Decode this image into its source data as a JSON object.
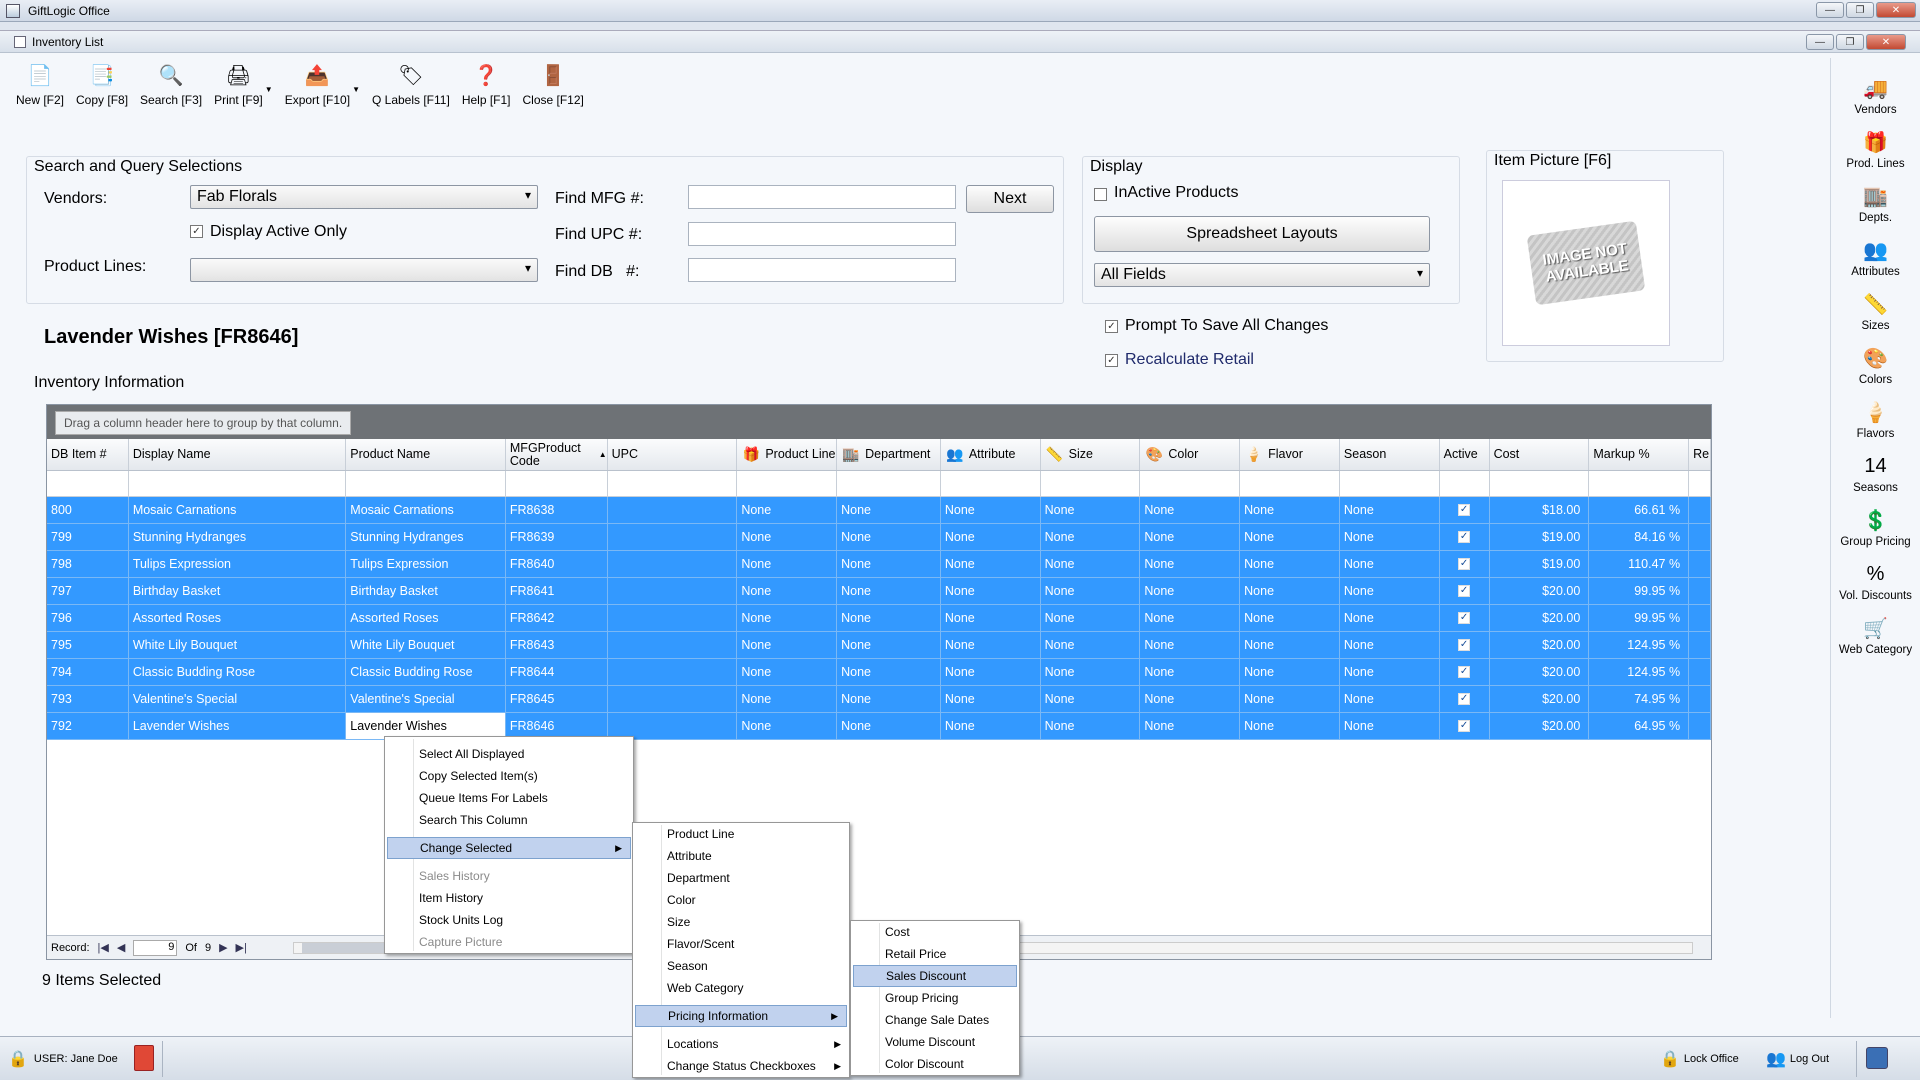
{
  "app": {
    "title": "GiftLogic Office"
  },
  "window": {
    "title": "Inventory List"
  },
  "toolbar": [
    {
      "label": "New [F2]",
      "icon": "new-document-icon",
      "glyph": "📄"
    },
    {
      "label": "Copy [F8]",
      "icon": "copy-icon",
      "glyph": "📑"
    },
    {
      "label": "Search [F3]",
      "icon": "search-icon",
      "glyph": "🔍"
    },
    {
      "label": "Print [F9]",
      "icon": "printer-icon",
      "glyph": "🖨"
    },
    {
      "label": "Export [F10]",
      "icon": "export-icon",
      "glyph": "📤"
    },
    {
      "label": "Q Labels [F11]",
      "icon": "label-tag-icon",
      "glyph": "🏷"
    },
    {
      "label": "Help [F1]",
      "icon": "help-icon",
      "glyph": "❓"
    },
    {
      "label": "Close [F12]",
      "icon": "close-door-icon",
      "glyph": "🚪"
    }
  ],
  "sidebar": [
    {
      "label": "Vendors",
      "icon": "vendors-icon",
      "glyph": "🚚"
    },
    {
      "label": "Prod. Lines",
      "icon": "product-lines-icon",
      "glyph": "🎁"
    },
    {
      "label": "Depts.",
      "icon": "departments-icon",
      "glyph": "🏬"
    },
    {
      "label": "Attributes",
      "icon": "attributes-icon",
      "glyph": "👥"
    },
    {
      "label": "Sizes",
      "icon": "sizes-icon",
      "glyph": "📏"
    },
    {
      "label": "Colors",
      "icon": "colors-icon",
      "glyph": "🎨"
    },
    {
      "label": "Flavors",
      "icon": "flavors-icon",
      "glyph": "🍦"
    },
    {
      "label": "Seasons",
      "icon": "seasons-calendar-icon",
      "glyph": "14"
    },
    {
      "label": "Group Pricing",
      "icon": "group-pricing-icon",
      "glyph": "💲"
    },
    {
      "label": "Vol. Discounts",
      "icon": "volume-discounts-icon",
      "glyph": "%"
    },
    {
      "label": "Web Category",
      "icon": "web-category-cart-icon",
      "glyph": "🛒"
    }
  ],
  "search": {
    "heading": "Search and Query Selections",
    "vendors_label": "Vendors:",
    "vendors_value": "Fab Florals",
    "display_active_label": "Display Active Only",
    "product_lines_label": "Product Lines:",
    "product_lines_value": "",
    "find_mfg_label": "Find MFG #:",
    "find_upc_label": "Find UPC #:",
    "find_db_label": "Find DB   #:",
    "next_label": "Next"
  },
  "display": {
    "heading": "Display",
    "inactive_label": "InActive Products",
    "spreadsheet_label": "Spreadsheet Layouts",
    "fields_value": "All Fields",
    "prompt_label": "Prompt To Save All Changes",
    "recalc_label": "Recalculate Retail"
  },
  "item_picture": {
    "heading": "Item Picture [F6]",
    "placeholder": "IMAGE NOT AVAILABLE"
  },
  "item_title": "Lavender Wishes  [FR8646]",
  "inventory": {
    "heading": "Inventory Information",
    "group_hint": "Drag a column header here to group by that column.",
    "columns": [
      {
        "label": "DB Item #",
        "icon": ""
      },
      {
        "label": "Display Name",
        "icon": ""
      },
      {
        "label": "Product Name",
        "icon": ""
      },
      {
        "label": "MFGProduct Code",
        "icon": ""
      },
      {
        "label": "UPC",
        "icon": ""
      },
      {
        "label": "Product Line",
        "icon": "🎁"
      },
      {
        "label": "Department",
        "icon": "🏬"
      },
      {
        "label": "Attribute",
        "icon": "👥"
      },
      {
        "label": "Size",
        "icon": "📏"
      },
      {
        "label": "Color",
        "icon": "🎨"
      },
      {
        "label": "Flavor",
        "icon": "🍦"
      },
      {
        "label": "Season",
        "icon": ""
      },
      {
        "label": "Active",
        "icon": ""
      },
      {
        "label": "Cost",
        "icon": ""
      },
      {
        "label": "Markup %",
        "icon": ""
      },
      {
        "label": "Re",
        "icon": ""
      }
    ],
    "rows": [
      {
        "id": "800",
        "display": "Mosaic Carnations",
        "product": "Mosaic Carnations",
        "mfg": "FR8638",
        "upc": "",
        "line": "None",
        "dept": "None",
        "attr": "None",
        "size": "None",
        "color": "None",
        "flavor": "None",
        "season": "None",
        "cost": "$18.00",
        "markup": "66.61 %"
      },
      {
        "id": "799",
        "display": "Stunning Hydranges",
        "product": "Stunning Hydranges",
        "mfg": "FR8639",
        "upc": "",
        "line": "None",
        "dept": "None",
        "attr": "None",
        "size": "None",
        "color": "None",
        "flavor": "None",
        "season": "None",
        "cost": "$19.00",
        "markup": "84.16 %"
      },
      {
        "id": "798",
        "display": "Tulips Expression",
        "product": "Tulips Expression",
        "mfg": "FR8640",
        "upc": "",
        "line": "None",
        "dept": "None",
        "attr": "None",
        "size": "None",
        "color": "None",
        "flavor": "None",
        "season": "None",
        "cost": "$19.00",
        "markup": "110.47 %"
      },
      {
        "id": "797",
        "display": "Birthday Basket",
        "product": "Birthday Basket",
        "mfg": "FR8641",
        "upc": "",
        "line": "None",
        "dept": "None",
        "attr": "None",
        "size": "None",
        "color": "None",
        "flavor": "None",
        "season": "None",
        "cost": "$20.00",
        "markup": "99.95 %"
      },
      {
        "id": "796",
        "display": "Assorted Roses",
        "product": "Assorted Roses",
        "mfg": "FR8642",
        "upc": "",
        "line": "None",
        "dept": "None",
        "attr": "None",
        "size": "None",
        "color": "None",
        "flavor": "None",
        "season": "None",
        "cost": "$20.00",
        "markup": "99.95 %"
      },
      {
        "id": "795",
        "display": "White Lily Bouquet",
        "product": "White Lily Bouquet",
        "mfg": "FR8643",
        "upc": "",
        "line": "None",
        "dept": "None",
        "attr": "None",
        "size": "None",
        "color": "None",
        "flavor": "None",
        "season": "None",
        "cost": "$20.00",
        "markup": "124.95 %"
      },
      {
        "id": "794",
        "display": "Classic Budding Rose",
        "product": "Classic Budding Rose",
        "mfg": "FR8644",
        "upc": "",
        "line": "None",
        "dept": "None",
        "attr": "None",
        "size": "None",
        "color": "None",
        "flavor": "None",
        "season": "None",
        "cost": "$20.00",
        "markup": "124.95 %"
      },
      {
        "id": "793",
        "display": "Valentine's Special",
        "product": "Valentine's Special",
        "mfg": "FR8645",
        "upc": "",
        "line": "None",
        "dept": "None",
        "attr": "None",
        "size": "None",
        "color": "None",
        "flavor": "None",
        "season": "None",
        "cost": "$20.00",
        "markup": "74.95 %"
      },
      {
        "id": "792",
        "display": "Lavender Wishes",
        "product": "Lavender Wishes",
        "mfg": "FR8646",
        "upc": "",
        "line": "None",
        "dept": "None",
        "attr": "None",
        "size": "None",
        "color": "None",
        "flavor": "None",
        "season": "None",
        "cost": "$20.00",
        "markup": "64.95 %"
      }
    ],
    "record_label": "Record:",
    "record_value": "9",
    "record_of": "Of",
    "record_total": "9"
  },
  "selected_count": "9 Items Selected",
  "context_menu": {
    "items": [
      "Select All Displayed",
      "Copy Selected Item(s)",
      "Queue Items For Labels",
      "Search This Column"
    ],
    "change_selected": "Change Selected",
    "items2": [
      "Sales History",
      "Item History",
      "Stock Units Log",
      "Capture Picture"
    ]
  },
  "submenu": {
    "items": [
      "Product Line",
      "Attribute",
      "Department",
      "Color",
      "Size",
      "Flavor/Scent",
      "Season",
      "Web Category"
    ],
    "pricing": "Pricing Information",
    "locations": "Locations",
    "status": "Change Status Checkboxes"
  },
  "pricing_menu": {
    "items": [
      "Cost",
      "Retail Price",
      "Sales Discount",
      "Group Pricing",
      "Change Sale Dates",
      "Volume Discount",
      "Color Discount"
    ]
  },
  "status_bar": {
    "user": "USER: Jane Doe",
    "lock": "Lock Office",
    "logout": "Log Out"
  },
  "colors": {
    "selection": "#3399ff",
    "menu_highlight": "#c1d2ee"
  }
}
